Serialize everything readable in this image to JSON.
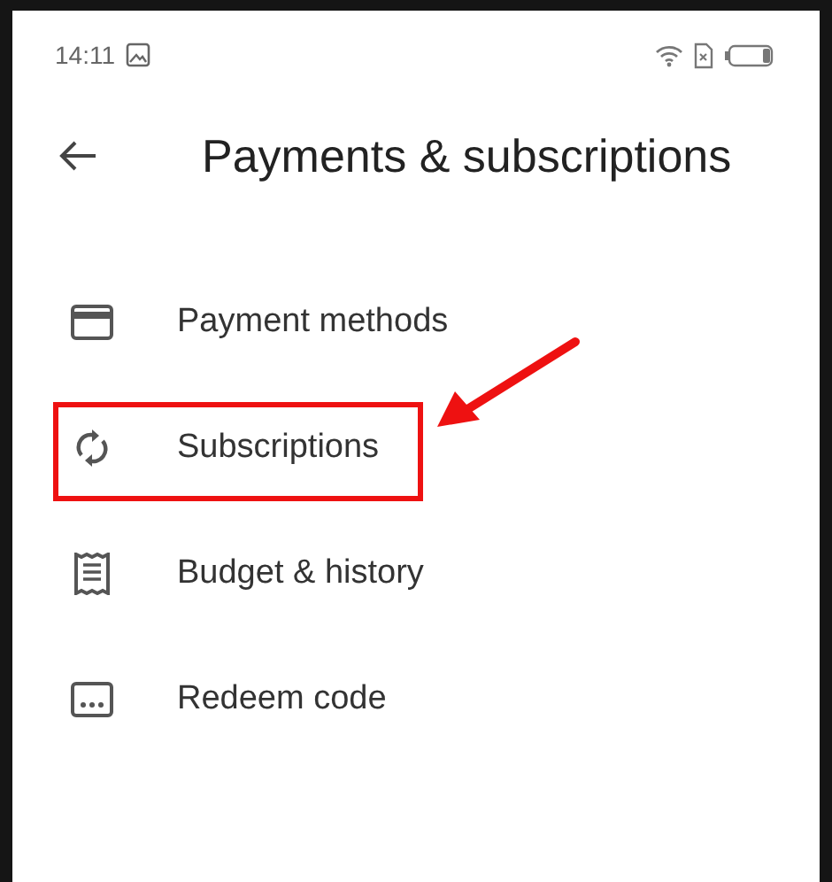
{
  "status_bar": {
    "time": "14:11"
  },
  "header": {
    "title": "Payments & subscriptions"
  },
  "menu_items": [
    {
      "label": "Payment methods",
      "kind": "card",
      "highlighted": false
    },
    {
      "label": "Subscriptions",
      "kind": "sync",
      "highlighted": true
    },
    {
      "label": "Budget & history",
      "kind": "receipt",
      "highlighted": false
    },
    {
      "label": "Redeem code",
      "kind": "code",
      "highlighted": false
    }
  ]
}
